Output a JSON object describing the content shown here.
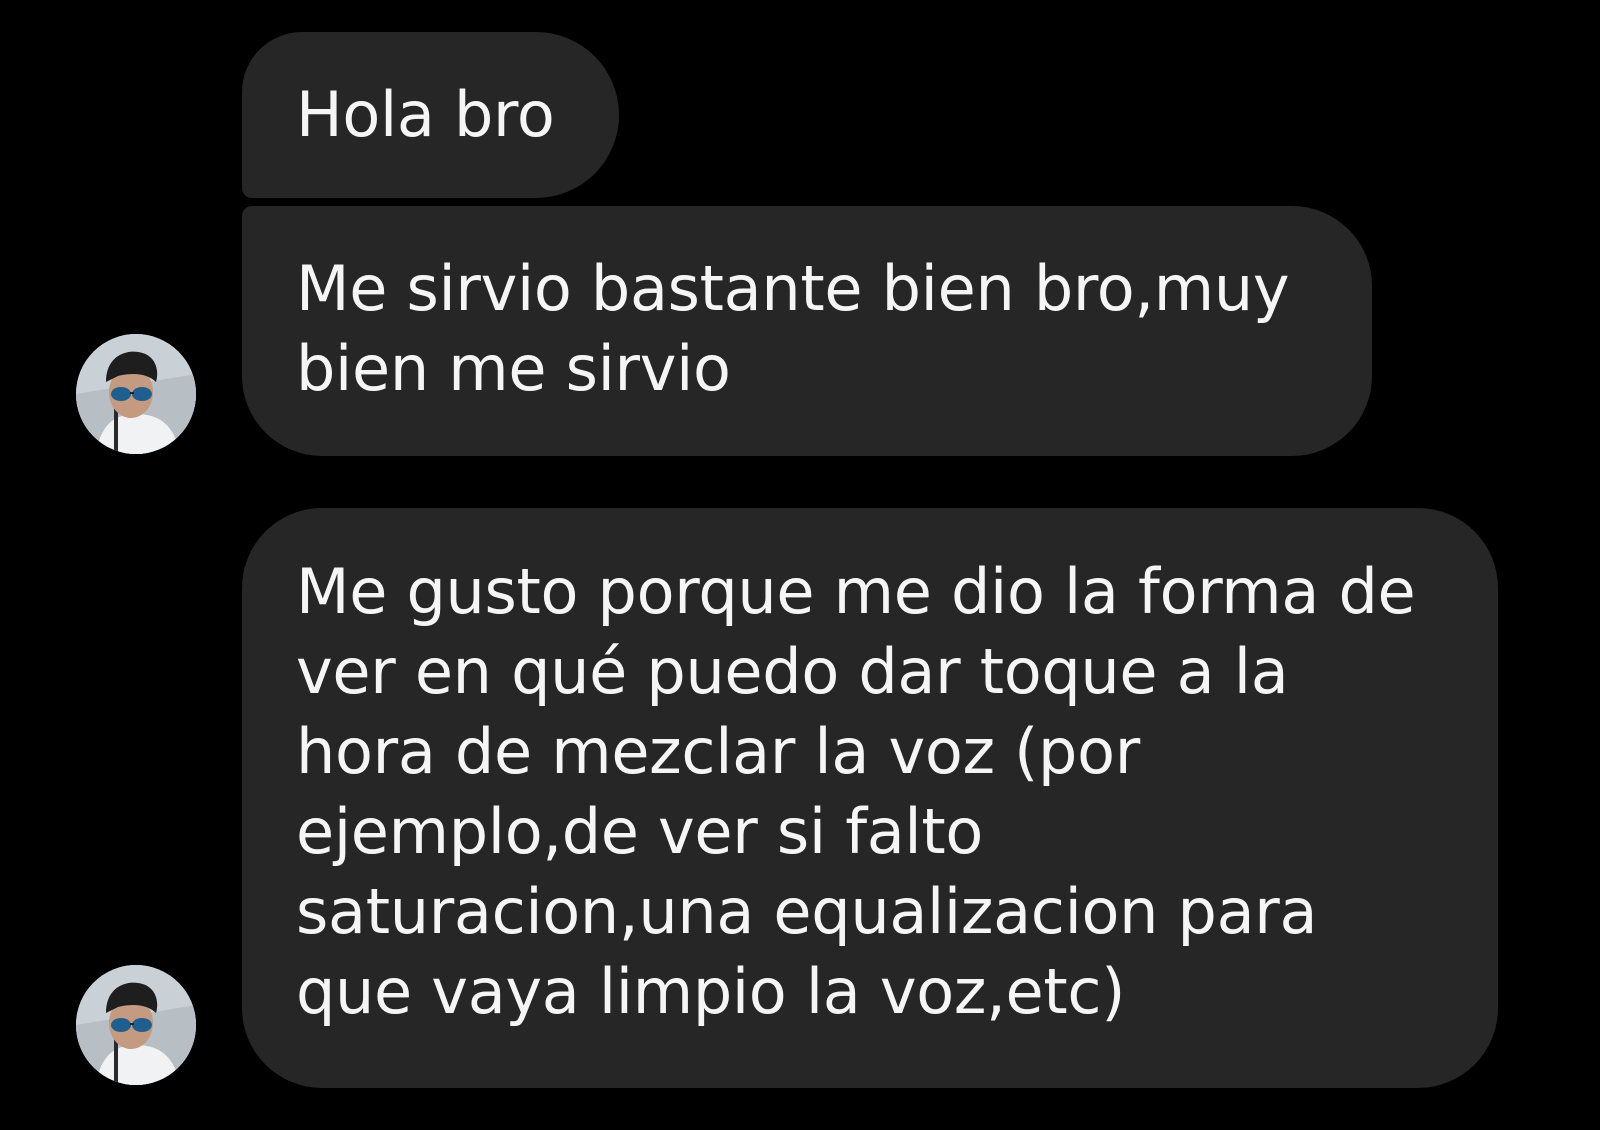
{
  "conversation": {
    "messages": [
      {
        "lines": [
          "Hola bro"
        ]
      },
      {
        "lines": [
          "Me sirvio bastante bien bro,muy",
          "bien me sirvio"
        ]
      },
      {
        "lines": [
          "Me gusto porque me dio la forma de",
          "ver en qué puedo dar toque a la",
          "hora de mezclar la voz (por",
          "ejemplo,de ver si falto",
          "saturacion,una equalizacion para",
          "que vaya limpio la voz,etc)"
        ]
      }
    ],
    "avatar_icon": "profile-photo-avatar"
  },
  "colors": {
    "background": "#000000",
    "bubble": "#262626",
    "text": "#f5f5f5"
  }
}
